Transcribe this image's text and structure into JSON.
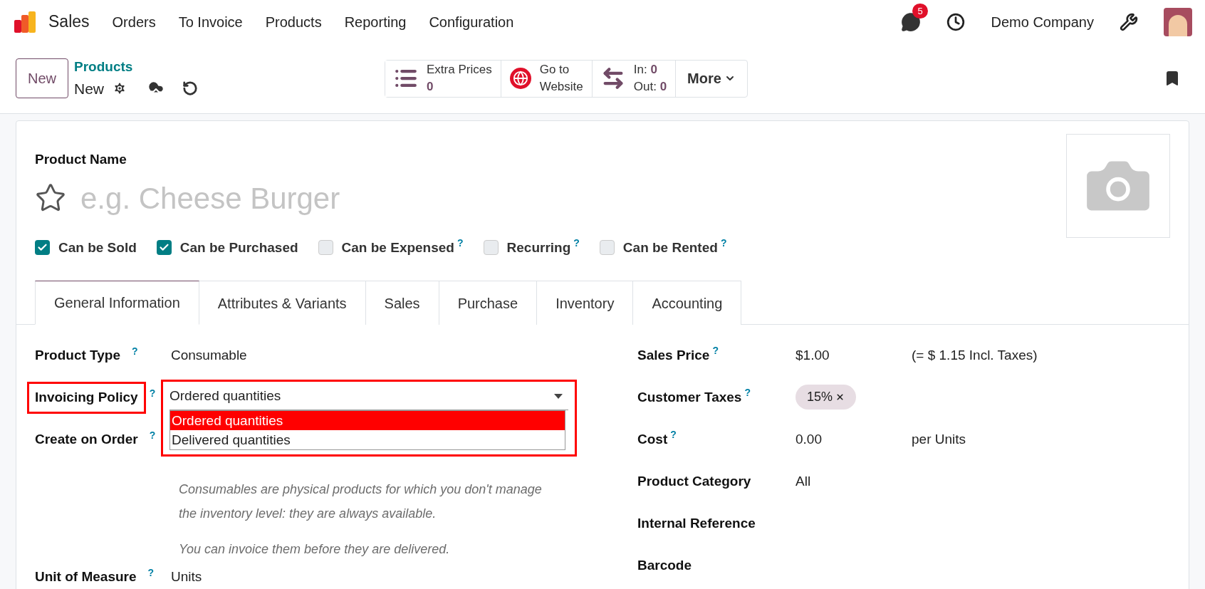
{
  "navbar": {
    "app": "Sales",
    "menu": [
      "Orders",
      "To Invoice",
      "Products",
      "Reporting",
      "Configuration"
    ],
    "messages_badge": "5",
    "company": "Demo Company"
  },
  "control_panel": {
    "new_button": "New",
    "breadcrumb": "Products",
    "record": "New",
    "smart_buttons": [
      {
        "kind": "list",
        "label": "Extra Prices",
        "value": "0"
      },
      {
        "kind": "globe",
        "label": "Go to",
        "value": "Website"
      },
      {
        "kind": "transfer",
        "label": "In: ",
        "value": "0",
        "label2": "Out: ",
        "value2": "0"
      }
    ],
    "more": "More"
  },
  "form": {
    "name_label": "Product Name",
    "name_placeholder": "e.g. Cheese Burger",
    "starred": false,
    "options": [
      {
        "label": "Can be Sold",
        "checked": true
      },
      {
        "label": "Can be Purchased",
        "checked": true
      },
      {
        "label": "Can be Expensed",
        "checked": false,
        "help": "?"
      },
      {
        "label": "Recurring",
        "checked": false,
        "help": "?"
      },
      {
        "label": "Can be Rented",
        "checked": false,
        "help": "?"
      }
    ],
    "tabs": [
      {
        "label": "General Information",
        "selected": true
      },
      {
        "label": "Attributes & Variants",
        "selected": false
      },
      {
        "label": "Sales",
        "selected": false
      },
      {
        "label": "Purchase",
        "selected": false
      },
      {
        "label": "Inventory",
        "selected": false
      },
      {
        "label": "Accounting",
        "selected": false
      }
    ],
    "left_fields": [
      {
        "kind": "text",
        "label": "Product Type",
        "help": "?",
        "value": "Consumable",
        "highlighted": false
      },
      {
        "kind": "select",
        "label": "Invoicing Policy",
        "help": "?",
        "value": "Ordered quantities",
        "highlighted": true,
        "options": [
          {
            "label": "Ordered quantities",
            "selected": true
          },
          {
            "label": "Delivered quantities",
            "selected": false
          }
        ]
      },
      {
        "kind": "empty",
        "label": "Create on Order",
        "help": "?",
        "highlighted": false
      },
      {
        "kind": "note",
        "paragraphs": [
          "Consumables are physical products for which you don't manage the inventory level: they are always available.",
          "You can invoice them before they are delivered."
        ]
      },
      {
        "kind": "text",
        "label": "Unit of Measure",
        "help": "?",
        "value": "Units",
        "highlighted": false
      }
    ],
    "right_fields": [
      {
        "kind": "price",
        "label": "Sales Price",
        "help": "?",
        "value": "$1.00",
        "extra": "(= $ 1.15 Incl. Taxes)"
      },
      {
        "kind": "tags",
        "label": "Customer Taxes",
        "help": "?",
        "tags": [
          "15%"
        ]
      },
      {
        "kind": "price",
        "label": "Cost",
        "help": "?",
        "value": "0.00",
        "extra": "per Units"
      },
      {
        "kind": "text",
        "label": "Product Category",
        "value": "All"
      },
      {
        "kind": "text",
        "label": "Internal Reference"
      },
      {
        "kind": "text",
        "label": "Barcode"
      }
    ]
  }
}
